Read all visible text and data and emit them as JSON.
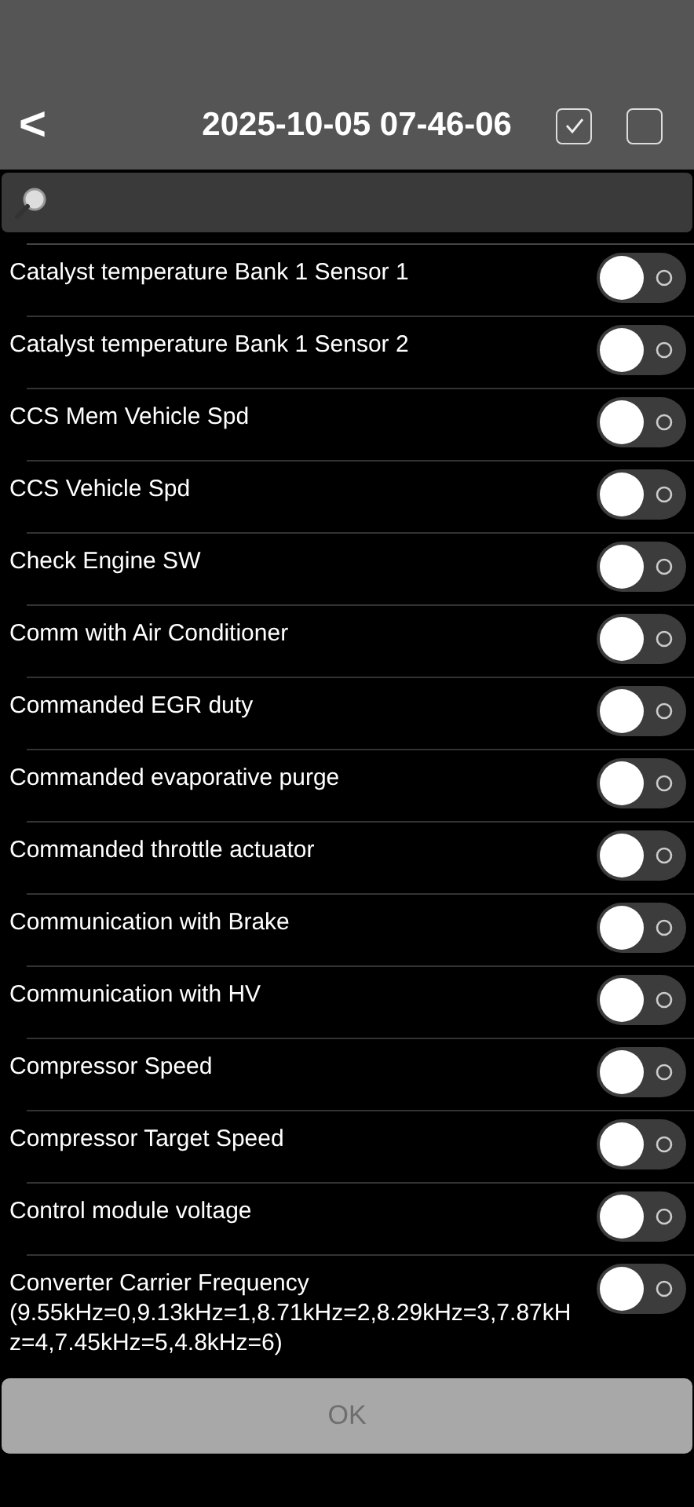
{
  "header": {
    "back": "<",
    "title": "2025-10-05 07-46-06",
    "checkboxes": [
      {
        "checked": true
      },
      {
        "checked": false
      }
    ]
  },
  "items": [
    {
      "label": "Catalyst temperature Bank 1 Sensor 1",
      "on": false
    },
    {
      "label": "Catalyst temperature Bank 1 Sensor 2",
      "on": false
    },
    {
      "label": "CCS Mem Vehicle Spd",
      "on": false
    },
    {
      "label": "CCS Vehicle Spd",
      "on": false
    },
    {
      "label": "Check Engine SW",
      "on": false
    },
    {
      "label": "Comm with Air Conditioner",
      "on": false
    },
    {
      "label": "Commanded EGR duty",
      "on": false
    },
    {
      "label": "Commanded evaporative purge",
      "on": false
    },
    {
      "label": "Commanded throttle actuator",
      "on": false
    },
    {
      "label": "Communication with Brake",
      "on": false
    },
    {
      "label": "Communication with HV",
      "on": false
    },
    {
      "label": "Compressor Speed",
      "on": false
    },
    {
      "label": "Compressor Target Speed",
      "on": false
    },
    {
      "label": "Control module voltage",
      "on": false
    },
    {
      "label": "Converter Carrier Frequency (9.55kHz=0,9.13kHz=1,8.71kHz=2,8.29kHz=3,7.87kHz=4,7.45kHz=5,4.8kHz=6)",
      "on": false
    }
  ],
  "ok_button": {
    "label": "OK",
    "disabled": true
  }
}
